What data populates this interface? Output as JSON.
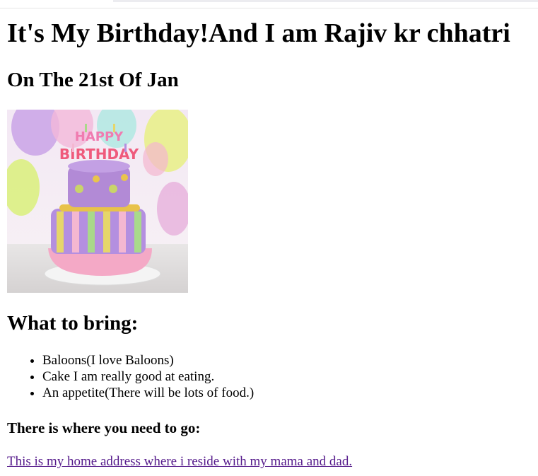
{
  "page": {
    "title": "It's My Birthday!And I am Rajiv kr chhatri",
    "subtitle": "On The 21st Of Jan"
  },
  "image": {
    "icon": "birthday-cake-image",
    "alt": "Happy Birthday cake",
    "topper_text": "HAPPY BIRTHDAY"
  },
  "bring": {
    "heading": "What to bring:",
    "items": [
      "Baloons(I love Baloons)",
      "Cake I am really good at eating.",
      "An appetite(There will be lots of food.)"
    ]
  },
  "location": {
    "heading": "There is where you need to go:",
    "link_text": "This is my home address where i reside with my mama and dad."
  },
  "colors": {
    "visited_link": "#551a8b",
    "text": "#000000",
    "background": "#ffffff"
  }
}
